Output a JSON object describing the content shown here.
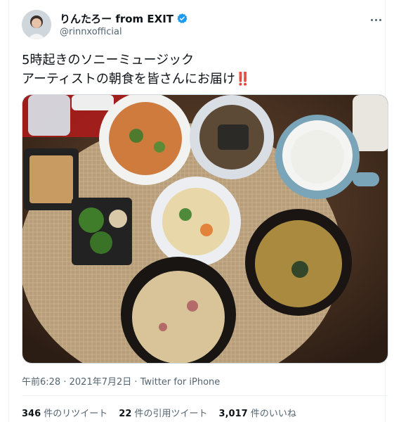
{
  "tweet": {
    "display_name": "りんたろー from EXIT",
    "handle": "@rinnxofficial",
    "text_line1": "5時起きのソニーミュージック",
    "text_line2": "アーティストの朝食を皆さんにお届け",
    "emoji": "‼️",
    "time": "午前6:28",
    "date": "2021年7月2日",
    "source": "Twitter for iPhone",
    "separator": "·"
  },
  "stats": {
    "retweets_count": "346",
    "retweets_label": "件のリツイート",
    "quotes_count": "22",
    "quotes_label": "件の引用ツイート",
    "likes_count": "3,017",
    "likes_label": "件のいいね"
  },
  "icons": {
    "verified": "verified-badge-icon",
    "more": "more-options-icon"
  },
  "colors": {
    "text_primary": "#0f1419",
    "text_secondary": "#536471",
    "verified_blue": "#1d9bf0",
    "emoji_red": "#d0192d"
  }
}
